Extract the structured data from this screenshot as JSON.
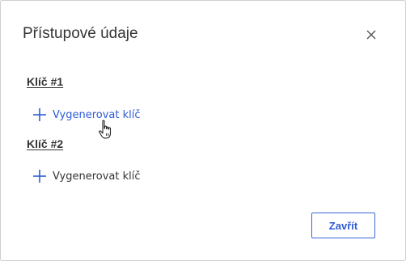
{
  "dialog": {
    "title": "Přístupové údaje",
    "close_icon": "close-icon",
    "close_button_label": "Zavřít"
  },
  "keys": [
    {
      "heading": "Klíč #1",
      "action_label": "Vygenerovat klíč",
      "action_icon": "plus-icon",
      "hovered": true
    },
    {
      "heading": "Klíč #2",
      "action_label": "Vygenerovat klíč",
      "action_icon": "plus-icon",
      "hovered": false
    }
  ],
  "colors": {
    "accent": "#2e5bd6",
    "text": "#333333",
    "border": "#cfcfcf"
  },
  "cursor": "hand-pointer-icon"
}
